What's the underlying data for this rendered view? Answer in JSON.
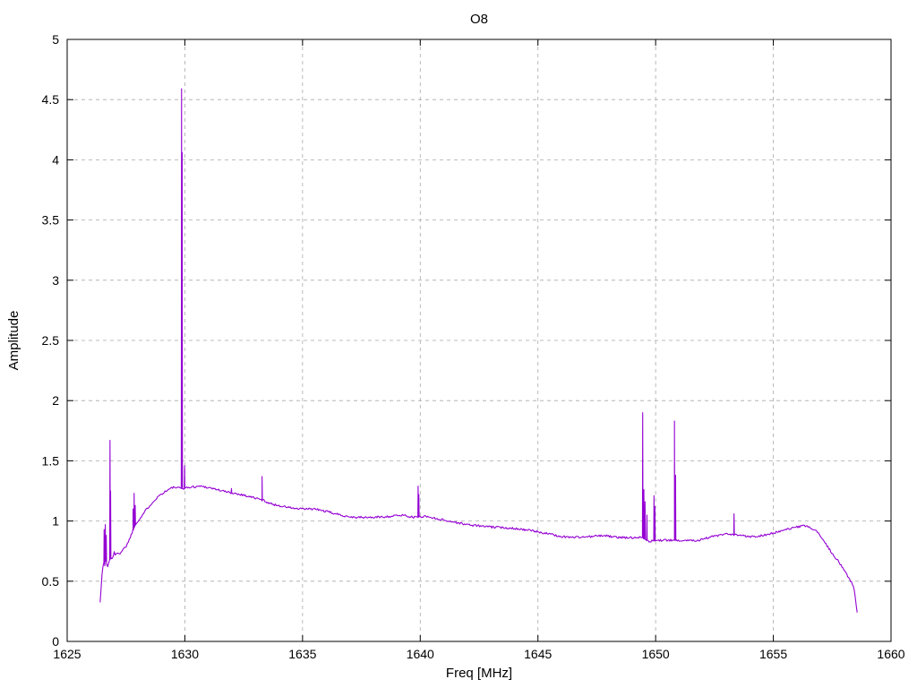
{
  "page": {
    "background": "#ffffff"
  },
  "chart_data": {
    "type": "line",
    "title": "O8",
    "xlabel": "Freq [MHz]",
    "ylabel": "Amplitude",
    "xlim": [
      1625,
      1660
    ],
    "ylim": [
      0,
      5
    ],
    "xticks": [
      1625,
      1630,
      1635,
      1640,
      1645,
      1650,
      1655,
      1660
    ],
    "yticks": [
      0,
      0.5,
      1,
      1.5,
      2,
      2.5,
      3,
      3.5,
      4,
      4.5,
      5
    ],
    "grid": true,
    "legend_position": "none",
    "line_color": "#9400D3",
    "grid_color": "#a9a9a9",
    "border_color": "#000000",
    "series": [
      {
        "name": "O8",
        "x_start": 1626.4,
        "x_end": 1658.56,
        "sample_step": 0.04,
        "noise_amplitude": 0.009,
        "envelope": [
          [
            1626.4,
            0.33
          ],
          [
            1626.44,
            0.44
          ],
          [
            1626.48,
            0.55
          ],
          [
            1626.52,
            0.62
          ],
          [
            1626.56,
            0.66
          ],
          [
            1626.6,
            0.63
          ],
          [
            1626.64,
            0.7
          ],
          [
            1626.68,
            0.64
          ],
          [
            1626.72,
            0.62
          ],
          [
            1626.78,
            0.66
          ],
          [
            1626.85,
            0.7
          ],
          [
            1626.9,
            0.68
          ],
          [
            1627.0,
            0.74
          ],
          [
            1627.05,
            0.71
          ],
          [
            1627.15,
            0.74
          ],
          [
            1627.25,
            0.73
          ],
          [
            1627.35,
            0.76
          ],
          [
            1627.5,
            0.79
          ],
          [
            1627.65,
            0.85
          ],
          [
            1627.75,
            0.9
          ],
          [
            1627.85,
            0.95
          ],
          [
            1627.95,
            0.99
          ],
          [
            1628.1,
            1.02
          ],
          [
            1628.3,
            1.08
          ],
          [
            1628.6,
            1.15
          ],
          [
            1628.9,
            1.21
          ],
          [
            1629.2,
            1.25
          ],
          [
            1629.5,
            1.28
          ],
          [
            1629.9,
            1.27
          ],
          [
            1630.2,
            1.28
          ],
          [
            1630.7,
            1.29
          ],
          [
            1631.2,
            1.27
          ],
          [
            1631.8,
            1.24
          ],
          [
            1632.4,
            1.22
          ],
          [
            1633.0,
            1.19
          ],
          [
            1633.35,
            1.17
          ],
          [
            1633.7,
            1.14
          ],
          [
            1634.2,
            1.12
          ],
          [
            1634.8,
            1.1
          ],
          [
            1635.5,
            1.1
          ],
          [
            1636.0,
            1.08
          ],
          [
            1636.6,
            1.05
          ],
          [
            1637.2,
            1.03
          ],
          [
            1638.0,
            1.03
          ],
          [
            1638.8,
            1.04
          ],
          [
            1639.3,
            1.05
          ],
          [
            1639.7,
            1.03
          ],
          [
            1640.2,
            1.04
          ],
          [
            1640.7,
            1.02
          ],
          [
            1641.2,
            1.0
          ],
          [
            1642.0,
            0.97
          ],
          [
            1643.0,
            0.95
          ],
          [
            1644.0,
            0.94
          ],
          [
            1644.7,
            0.92
          ],
          [
            1645.3,
            0.9
          ],
          [
            1646.0,
            0.87
          ],
          [
            1646.6,
            0.865
          ],
          [
            1647.2,
            0.87
          ],
          [
            1647.8,
            0.88
          ],
          [
            1648.3,
            0.865
          ],
          [
            1649.0,
            0.86
          ],
          [
            1649.4,
            0.87
          ],
          [
            1649.7,
            0.83
          ],
          [
            1650.05,
            0.84
          ],
          [
            1650.6,
            0.84
          ],
          [
            1651.2,
            0.84
          ],
          [
            1651.8,
            0.84
          ],
          [
            1652.4,
            0.87
          ],
          [
            1653.0,
            0.89
          ],
          [
            1653.6,
            0.88
          ],
          [
            1654.2,
            0.87
          ],
          [
            1654.8,
            0.89
          ],
          [
            1655.4,
            0.92
          ],
          [
            1656.0,
            0.95
          ],
          [
            1656.4,
            0.96
          ],
          [
            1656.8,
            0.92
          ],
          [
            1657.1,
            0.85
          ],
          [
            1657.4,
            0.76
          ],
          [
            1657.7,
            0.68
          ],
          [
            1658.0,
            0.6
          ],
          [
            1658.2,
            0.53
          ],
          [
            1658.35,
            0.48
          ],
          [
            1658.45,
            0.42
          ],
          [
            1658.52,
            0.3
          ],
          [
            1658.56,
            0.24
          ]
        ],
        "spikes": [
          [
            1626.57,
            0.93
          ],
          [
            1626.62,
            0.97
          ],
          [
            1626.66,
            0.88
          ],
          [
            1626.82,
            1.67
          ],
          [
            1626.845,
            1.25
          ],
          [
            1627.8,
            1.1
          ],
          [
            1627.845,
            1.23
          ],
          [
            1627.89,
            1.13
          ],
          [
            1629.86,
            4.59
          ],
          [
            1629.885,
            4.06
          ],
          [
            1629.99,
            1.46
          ],
          [
            1631.98,
            1.27
          ],
          [
            1633.28,
            1.37
          ],
          [
            1639.91,
            1.29
          ],
          [
            1639.94,
            1.22
          ],
          [
            1649.45,
            1.9
          ],
          [
            1649.5,
            1.26
          ],
          [
            1649.55,
            1.16
          ],
          [
            1649.63,
            1.05
          ],
          [
            1649.93,
            1.21
          ],
          [
            1649.97,
            1.12
          ],
          [
            1650.8,
            1.83
          ],
          [
            1650.845,
            1.38
          ],
          [
            1653.33,
            1.06
          ]
        ]
      }
    ]
  }
}
